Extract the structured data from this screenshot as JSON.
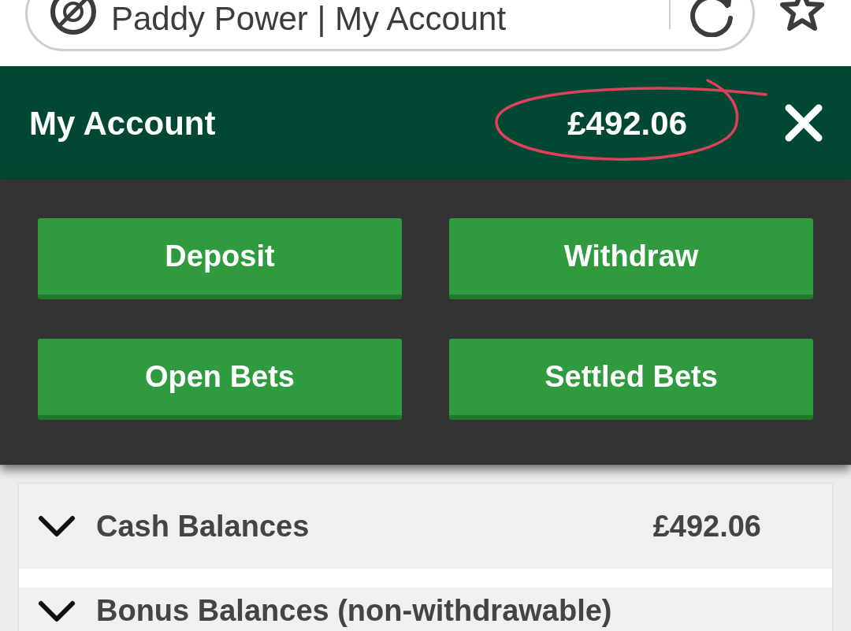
{
  "browser_bar": {
    "title": "Paddy Power | My Account"
  },
  "header": {
    "title": "My Account",
    "balance": "£492.06",
    "balance_circled": true
  },
  "actions": [
    {
      "label": "Deposit"
    },
    {
      "label": "Withdraw"
    },
    {
      "label": "Open Bets"
    },
    {
      "label": "Settled Bets"
    }
  ],
  "balances": [
    {
      "label": "Cash Balances",
      "amount": "£492.06",
      "expanded": false
    },
    {
      "label": "Bonus Balances (non-withdrawable)",
      "expanded": false
    }
  ]
}
